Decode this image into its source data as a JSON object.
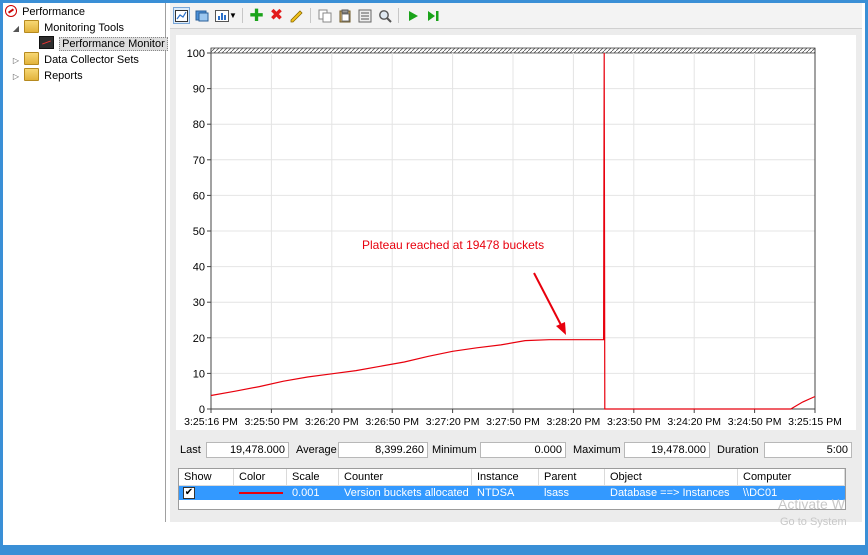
{
  "tree": {
    "root": "Performance",
    "monitoring_tools": "Monitoring Tools",
    "performance_monitor": "Performance Monitor",
    "data_collector_sets": "Data Collector Sets",
    "reports": "Reports"
  },
  "toolbar": {
    "icons": [
      "view-graph-icon",
      "copy-properties-icon",
      "change-graph-type-icon",
      "dropdown-arrow-icon",
      "add-counter-icon",
      "delete-counter-icon",
      "highlight-icon",
      "copy-icon",
      "paste-icon",
      "properties-icon",
      "zoom-icon",
      "update-data-icon",
      "freeze-display-icon"
    ]
  },
  "chart_data": {
    "type": "line",
    "title": "",
    "xlabel": "",
    "ylabel": "",
    "ylim": [
      0,
      100
    ],
    "yticks": [
      "100",
      "90",
      "80",
      "70",
      "60",
      "50",
      "40",
      "30",
      "20",
      "10",
      "0"
    ],
    "xticks": [
      "3:25:16 PM",
      "3:25:50 PM",
      "3:26:20 PM",
      "3:26:50 PM",
      "3:27:20 PM",
      "3:27:50 PM",
      "3:28:20 PM",
      "3:23:50 PM",
      "3:24:20 PM",
      "3:24:50 PM",
      "3:25:15 PM"
    ],
    "grid": true,
    "series": [
      {
        "color": "#e8000d",
        "x": [
          0,
          4,
          8,
          12,
          16,
          20,
          24,
          28,
          32,
          36,
          40,
          44,
          48,
          52,
          56,
          60,
          62,
          64,
          65,
          65.1,
          65.2,
          66,
          70,
          74,
          78,
          82,
          86,
          90,
          94,
          96,
          97,
          98,
          100
        ],
        "values": [
          3.8,
          5.0,
          6.3,
          7.8,
          9.0,
          9.9,
          10.8,
          12.0,
          13.2,
          14.8,
          16.2,
          17.2,
          18.0,
          19.2,
          19.478,
          19.478,
          19.478,
          19.478,
          19.478,
          100,
          0,
          0,
          0,
          0,
          0,
          0,
          0,
          0,
          0,
          0,
          1.0,
          2.0,
          3.5
        ]
      }
    ],
    "annotations": [
      {
        "text": "Plateau reached at 19478 buckets",
        "color": "#e8000d"
      }
    ]
  },
  "stats": {
    "last_label": "Last",
    "last_value": "19,478.000",
    "average_label": "Average",
    "average_value": "8,399.260",
    "minimum_label": "Minimum",
    "minimum_value": "0.000",
    "maximum_label": "Maximum",
    "maximum_value": "19,478.000",
    "duration_label": "Duration",
    "duration_value": "5:00"
  },
  "counters": {
    "headers": [
      "Show",
      "Color",
      "Scale",
      "Counter",
      "Instance",
      "Parent",
      "Object",
      "Computer"
    ],
    "rows": [
      {
        "show": "✔",
        "color": "#e8000d",
        "scale": "0.001",
        "counter": "Version buckets allocated",
        "instance": "NTDSA",
        "parent": "lsass",
        "object": "Database ==> Instances",
        "computer": "\\\\DC01"
      }
    ]
  },
  "watermark": {
    "line1": "Activate W",
    "line2": "Go to System"
  }
}
